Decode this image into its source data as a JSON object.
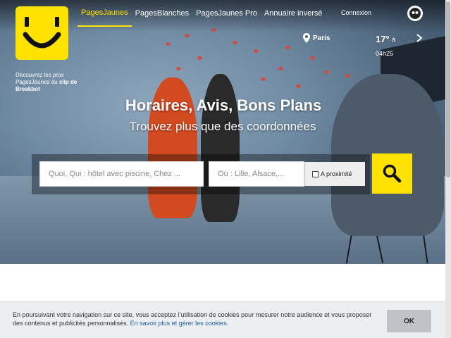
{
  "header": {
    "tabs": [
      {
        "label": "PagesJaunes"
      },
      {
        "label": "PagesBlanches"
      },
      {
        "label": "PagesJaunes Pro"
      },
      {
        "label": "Annuaire inversé"
      }
    ],
    "connexion_label": "Connexion",
    "logo_icon": "smiley-logo-icon"
  },
  "promo": {
    "text": "Découvrez les pros PagesJaunes du",
    "link": "clip de Breakbot"
  },
  "location": {
    "city": "Paris"
  },
  "weather": {
    "temp": "17°",
    "suffix": "à",
    "time": "04h25"
  },
  "hero": {
    "headline": "Horaires, Avis, Bons Plans",
    "tagline": "Trouvez plus que des coordonnées"
  },
  "search": {
    "what_placeholder": "Quoi, Qui : hôtel avec piscine, Chez ...",
    "where_placeholder": "Où : Lille, Alsace,...",
    "proximity_label": "A proximité"
  },
  "cookie": {
    "text": "En poursuivant votre navigation sur ce site, vous acceptez l’utilisation de cookies pour mesurer notre audience et vous proposer des contenus et publicités personnalisés.",
    "link": "En savoir plus et gérer les cookies.",
    "ok_label": "OK"
  },
  "colors": {
    "brand_yellow": "#ffe200",
    "link_blue": "#1d5fa8"
  }
}
